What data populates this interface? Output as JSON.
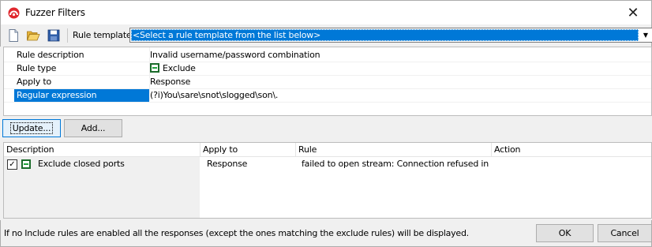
{
  "window": {
    "title": "Fuzzer Filters"
  },
  "toolbar": {
    "buttons": [
      "new-file-icon",
      "open-folder-icon",
      "save-disk-icon"
    ],
    "rule_template_label": "Rule template:",
    "rule_template_value": "<Select a rule template from the list below>"
  },
  "properties": [
    {
      "name": "Rule description",
      "value": "Invalid username/password combination"
    },
    {
      "name": "Rule type",
      "value": "Exclude",
      "icon": "exclude-icon"
    },
    {
      "name": "Apply to",
      "value": "Response"
    },
    {
      "name": "Regular expression",
      "value": "(?i)You\\sare\\snot\\slogged\\son\\.",
      "selected": true
    }
  ],
  "actions": {
    "update_label": "Update...",
    "add_label": "Add..."
  },
  "list": {
    "columns": [
      "Description",
      "Apply to",
      "Rule",
      "Action"
    ],
    "rows": [
      {
        "checked": true,
        "description": "Exclude closed ports",
        "apply_to": "Response",
        "rule": "failed to open stream: Connection refused in /hj/...",
        "action": ""
      }
    ]
  },
  "status": {
    "text": "If no Include rules are enabled all the responses (except the ones matching the exclude rules) will be displayed."
  },
  "dialog": {
    "ok_label": "OK",
    "cancel_label": "Cancel"
  },
  "colors": {
    "selection": "#0078d7",
    "exclude_green": "#1fa33b",
    "title_icon_red": "#e0282e"
  }
}
